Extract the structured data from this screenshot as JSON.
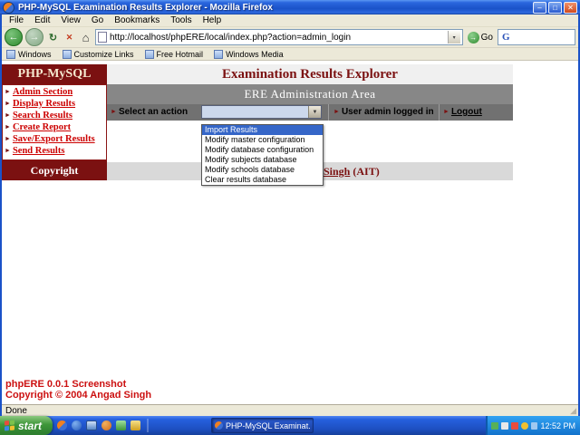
{
  "window": {
    "title": "PHP-MySQL Examination Results Explorer - Mozilla Firefox"
  },
  "menubar": {
    "items": [
      "File",
      "Edit",
      "View",
      "Go",
      "Bookmarks",
      "Tools",
      "Help"
    ]
  },
  "navbar": {
    "url": "http://localhost/phpERE/local/index.php?action=admin_login",
    "go_label": "Go"
  },
  "bookmarks_bar": {
    "items": [
      "Windows",
      "Customize Links",
      "Free Hotmail",
      "Windows Media"
    ]
  },
  "page": {
    "title": "Examination Results Explorer",
    "sidebar": {
      "brand": "PHP-MySQL",
      "links": [
        "Admin Section",
        "Display Results",
        "Search Results",
        "Create Report",
        "Save/Export Results",
        "Send Results"
      ],
      "copyright": "Copyright"
    },
    "admin_area": {
      "heading": "ERE Administration Area",
      "select_label": "Select an action",
      "user_status": "User admin logged in",
      "logout_label": "Logout",
      "dropdown_options": [
        "Import Results",
        "Modify master configuration",
        "Modify database configuration",
        "Modify subjects database",
        "Modify schools database",
        "Clear results database"
      ],
      "visible_user_name": "Singh",
      "visible_user_org": "(AIT)"
    },
    "footer": {
      "line1": "phpERE 0.0.1 Screenshot",
      "line2": "Copyright © 2004 Angad Singh"
    }
  },
  "statusbar": {
    "text": "Done"
  },
  "taskbar": {
    "start_label": "start",
    "task_button_label": "PHP-MySQL Examinat...",
    "clock": "12:52 PM"
  },
  "icons": {
    "bullet": "►",
    "back_arrow": "←",
    "forward_arrow": "→",
    "reload": "↻",
    "stop": "✕",
    "home": "⌂",
    "url_arrow": "▾",
    "select_arrow": "▼",
    "go_arrow": "→",
    "google_g": "G",
    "minimize": "–",
    "maximize": "□",
    "close": "✕"
  },
  "colors": {
    "brand_maroon": "#7b1111",
    "link_red": "#cc0000",
    "xp_taskbar_blue": "#2660de",
    "selection_blue": "#3566c8"
  }
}
